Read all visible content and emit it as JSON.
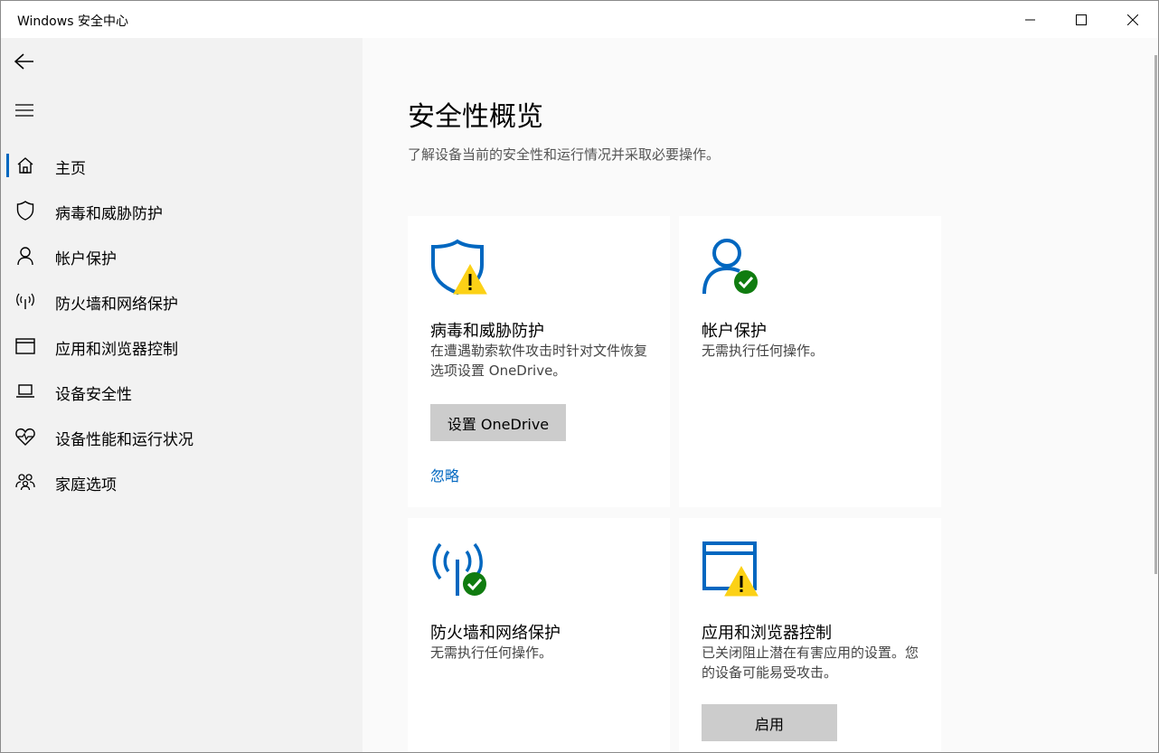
{
  "window": {
    "title": "Windows 安全中心"
  },
  "sidebar": {
    "items": [
      {
        "label": "主页",
        "icon": "home-icon",
        "selected": true
      },
      {
        "label": "病毒和威胁防护",
        "icon": "shield-icon"
      },
      {
        "label": "帐户保护",
        "icon": "person-icon"
      },
      {
        "label": "防火墙和网络保护",
        "icon": "antenna-icon"
      },
      {
        "label": "应用和浏览器控制",
        "icon": "browser-window-icon"
      },
      {
        "label": "设备安全性",
        "icon": "laptop-icon"
      },
      {
        "label": "设备性能和运行状况",
        "icon": "heart-pulse-icon"
      },
      {
        "label": "家庭选项",
        "icon": "family-icon"
      }
    ]
  },
  "main": {
    "title": "安全性概览",
    "subtitle": "了解设备当前的安全性和运行情况并采取必要操作。",
    "cards": [
      {
        "title": "病毒和威胁防护",
        "description": "在遭遇勒索软件攻击时针对文件恢复选项设置 OneDrive。",
        "button": "设置 OneDrive",
        "link": "忽略",
        "status": "warning"
      },
      {
        "title": "帐户保护",
        "description": "无需执行任何操作。",
        "status": "ok"
      },
      {
        "title": "防火墙和网络保护",
        "description": "无需执行任何操作。",
        "status": "ok"
      },
      {
        "title": "应用和浏览器控制",
        "description": "已关闭阻止潜在有害应用的设置。您的设备可能易受攻击。",
        "button": "启用",
        "status": "warning"
      }
    ]
  },
  "colors": {
    "accent": "#0067c0",
    "ok": "#107c10",
    "warning": "#fcd116"
  }
}
